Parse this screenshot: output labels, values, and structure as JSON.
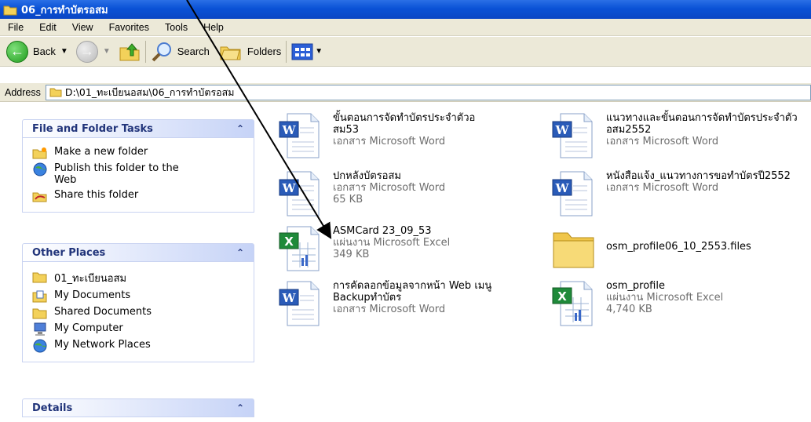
{
  "window": {
    "title": "06_การทำบัตรอสม"
  },
  "menu": [
    "File",
    "Edit",
    "View",
    "Favorites",
    "Tools",
    "Help"
  ],
  "toolbar": {
    "back": "Back",
    "search": "Search",
    "folders": "Folders"
  },
  "address": {
    "label": "Address",
    "path": "D:\\01_ทะเบียนอสม\\06_การทำบัตรอสม"
  },
  "sidebar": {
    "file_tasks": {
      "title": "File and Folder Tasks",
      "items": [
        "Make a new folder",
        "Publish this folder to the Web",
        "Share this folder"
      ]
    },
    "other_places": {
      "title": "Other Places",
      "items": [
        "01_ทะเบียนอสม",
        "My Documents",
        "Shared Documents",
        "My Computer",
        "My Network Places"
      ]
    },
    "details": {
      "title": "Details"
    }
  },
  "files": [
    {
      "name": "ขั้นตอนการจัดทำบัตรประจำตัวอสม53",
      "type": "เอกสาร Microsoft Word",
      "size": "",
      "icon": "word-doc-icon"
    },
    {
      "name": "แนวทางและขั้นตอนการจัดทำบัตรประจำตัวอสม2552",
      "type": "เอกสาร Microsoft Word",
      "size": "",
      "icon": "word-doc-icon"
    },
    {
      "name": "ปกหลังบัตรอสม",
      "type": "เอกสาร Microsoft Word",
      "size": "65 KB",
      "icon": "word-doc-icon"
    },
    {
      "name": "หนังสือแจ้ง_แนวทางการขอทำบัตรปี2552",
      "type": "เอกสาร Microsoft Word",
      "size": "",
      "icon": "word-doc-icon"
    },
    {
      "name": "ASMCard 23_09_53",
      "type": "แผ่นงาน Microsoft Excel",
      "size": "349 KB",
      "icon": "excel-sheet-icon"
    },
    {
      "name": "osm_profile06_10_2553.files",
      "type": "",
      "size": "",
      "icon": "folder-icon"
    },
    {
      "name": "การคัดลอกข้อมูลจากหน้า Web เมนู  Backupทำบัตร",
      "type": "เอกสาร Microsoft Word",
      "size": "",
      "icon": "word-doc-icon"
    },
    {
      "name": "osm_profile",
      "type": "แผ่นงาน Microsoft Excel",
      "size": "4,740 KB",
      "icon": "excel-sheet-icon"
    }
  ]
}
